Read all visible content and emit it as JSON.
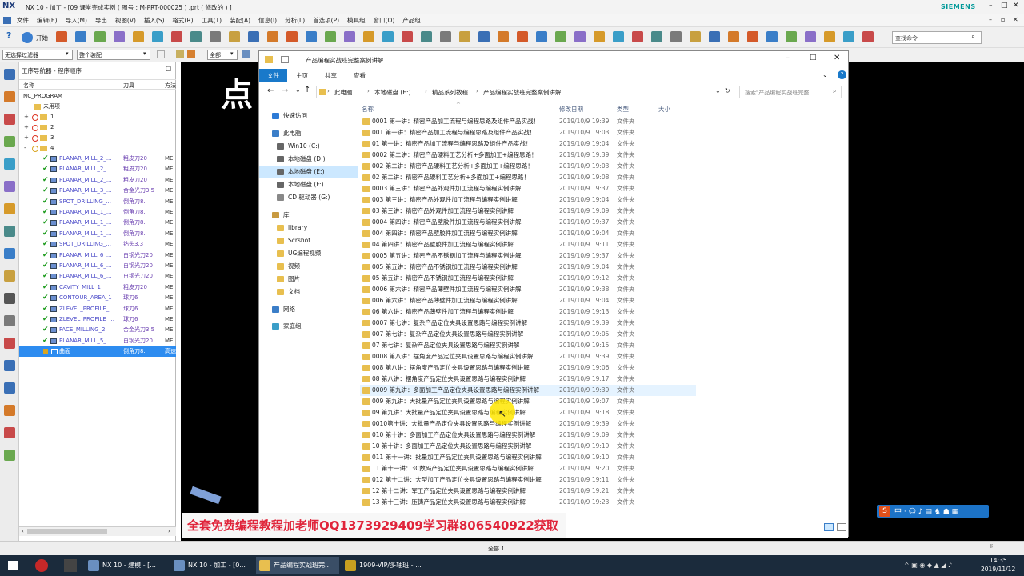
{
  "nx": {
    "logo": "NX",
    "title": "NX 10 - 加工 - [09 课堂完成实例 ( 图号 : M-PRT-000025 ) .prt ( 修改的 ) ]",
    "brand": "SIEMENS",
    "menu": [
      "文件",
      "编辑(E)",
      "导入(M)",
      "导出",
      "视图(V)",
      "插入(S)",
      "格式(R)",
      "工具(T)",
      "装配(A)",
      "信息(I)",
      "分析(L)",
      "首选项(P)",
      "模具组",
      "窗口(O)",
      "产品组"
    ],
    "start_label": "开始",
    "search_placeholder": "查找命令",
    "filter_value": "无选择过滤器",
    "assembly_value": "整个装配",
    "select_value": "全部",
    "status_text": "全部 1"
  },
  "navigator": {
    "title": "工序导航器 - 程序顺序",
    "col_name": "名称",
    "col_tool": "刀具",
    "col_method": "方法",
    "root": "NC_PROGRAM",
    "unused": "未用项",
    "groups": [
      "1",
      "2",
      "3",
      "4"
    ],
    "ops": [
      {
        "name": "PLANAR_MILL_2_...",
        "tool": "粗皮刀20",
        "mc": "ME"
      },
      {
        "name": "PLANAR_MILL_2_...",
        "tool": "粗皮刀20",
        "mc": "ME"
      },
      {
        "name": "PLANAR_MILL_2_...",
        "tool": "粗皮刀20",
        "mc": "ME"
      },
      {
        "name": "PLANAR_MILL_3_...",
        "tool": "合金光刀3.5",
        "mc": "ME"
      },
      {
        "name": "SPOT_DRILLING_...",
        "tool": "倒角刀8.",
        "mc": "ME"
      },
      {
        "name": "PLANAR_MILL_1_...",
        "tool": "倒角刀8.",
        "mc": "ME"
      },
      {
        "name": "PLANAR_MILL_1_...",
        "tool": "倒角刀8.",
        "mc": "ME"
      },
      {
        "name": "PLANAR_MILL_1_...",
        "tool": "倒角刀8.",
        "mc": "ME"
      },
      {
        "name": "SPOT_DRILLING_...",
        "tool": "钻头3.3",
        "mc": "ME"
      },
      {
        "name": "PLANAR_MILL_6_...",
        "tool": "白钢光刀20",
        "mc": "ME"
      },
      {
        "name": "PLANAR_MILL_6_...",
        "tool": "白钢光刀20",
        "mc": "ME"
      },
      {
        "name": "PLANAR_MILL_6_...",
        "tool": "白钢光刀20",
        "mc": "ME"
      },
      {
        "name": "CAVITY_MILL_1",
        "tool": "粗皮刀20",
        "mc": "ME"
      },
      {
        "name": "CONTOUR_AREA_1",
        "tool": "球刀6",
        "mc": "ME"
      },
      {
        "name": "ZLEVEL_PROFILE_...",
        "tool": "球刀6",
        "mc": "ME"
      },
      {
        "name": "ZLEVEL_PROFILE_...",
        "tool": "球刀6",
        "mc": "ME"
      },
      {
        "name": "FACE_MILLING_2",
        "tool": "合金光刀3.5",
        "mc": "ME"
      },
      {
        "name": "PLANAR_MILL_5_...",
        "tool": "白钢光刀20",
        "mc": "ME"
      }
    ],
    "selected": {
      "name": "曲面",
      "tool": "倒角刀8.",
      "mc": "高速"
    }
  },
  "viewport": {
    "overlay_char": "点"
  },
  "explorer": {
    "title": "产品编程实战班完整案例讲解",
    "tabs": [
      "文件",
      "主页",
      "共享",
      "查看"
    ],
    "breadcrumb": [
      "此电脑",
      "本地磁盘 (E:)",
      "精品系列教程",
      "产品编程实战班完整案例讲解"
    ],
    "search_placeholder": "搜索\"产品编程实战班完整...",
    "col_name": "名称",
    "col_date": "修改日期",
    "col_type": "类型",
    "col_size": "大小",
    "sidebar": [
      {
        "label": "快速访问",
        "kind": "star"
      },
      {
        "label": "此电脑",
        "kind": "pc"
      },
      {
        "label": "Win10 (C:)",
        "kind": "drive"
      },
      {
        "label": "本地磁盘 (D:)",
        "kind": "drive"
      },
      {
        "label": "本地磁盘 (E:)",
        "kind": "drive"
      },
      {
        "label": "本地磁盘 (F:)",
        "kind": "drive"
      },
      {
        "label": "CD 驱动器 (G:)",
        "kind": "cd"
      },
      {
        "label": "库",
        "kind": "lib"
      },
      {
        "label": "library",
        "kind": "folder"
      },
      {
        "label": "Scrshot",
        "kind": "folder"
      },
      {
        "label": "UG编程视频",
        "kind": "folder"
      },
      {
        "label": "视频",
        "kind": "folder"
      },
      {
        "label": "图片",
        "kind": "folder"
      },
      {
        "label": "文档",
        "kind": "folder"
      },
      {
        "label": "网络",
        "kind": "net"
      },
      {
        "label": "家庭组",
        "kind": "home"
      }
    ],
    "files": [
      {
        "name": "0001 第一讲：精密产品加工流程与编程思路及组件产品实战！",
        "date": "2019/10/9 19:39",
        "type": "文件夹"
      },
      {
        "name": "001 第一讲：精密产品加工流程与编程思路及组件产品实战！",
        "date": "2019/10/9 19:03",
        "type": "文件夹"
      },
      {
        "name": "01 第一讲：精密产品加工流程与编程思路及组件产品实战！",
        "date": "2019/10/9 19:04",
        "type": "文件夹"
      },
      {
        "name": "0002 第二讲：精密产品硬料工艺分析+多面加工+编程思路！",
        "date": "2019/10/9 19:39",
        "type": "文件夹"
      },
      {
        "name": "002 第二讲：精密产品硬料工艺分析+多面加工+编程思路！",
        "date": "2019/10/9 19:03",
        "type": "文件夹"
      },
      {
        "name": "02 第二讲：精密产品硬料工艺分析+多面加工+编程思路！",
        "date": "2019/10/9 19:08",
        "type": "文件夹"
      },
      {
        "name": "0003 第三讲：精密产品外观件加工流程与编程实例讲解",
        "date": "2019/10/9 19:37",
        "type": "文件夹"
      },
      {
        "name": "003 第三讲：精密产品外观件加工流程与编程实例讲解",
        "date": "2019/10/9 19:04",
        "type": "文件夹"
      },
      {
        "name": "03 第三讲：精密产品外观件加工流程与编程实例讲解",
        "date": "2019/10/9 19:09",
        "type": "文件夹"
      },
      {
        "name": "0004 第四讲：精密产品壁胶件加工流程与编程实例讲解",
        "date": "2019/10/9 19:37",
        "type": "文件夹"
      },
      {
        "name": "004 第四讲：精密产品壁胶件加工流程与编程实例讲解",
        "date": "2019/10/9 19:04",
        "type": "文件夹"
      },
      {
        "name": "04 第四讲：精密产品壁胶件加工流程与编程实例讲解",
        "date": "2019/10/9 19:11",
        "type": "文件夹"
      },
      {
        "name": "0005 第五讲：精密产品不锈钢加工流程与编程实例讲解",
        "date": "2019/10/9 19:37",
        "type": "文件夹"
      },
      {
        "name": "005 第五讲：精密产品不锈钢加工流程与编程实例讲解",
        "date": "2019/10/9 19:04",
        "type": "文件夹"
      },
      {
        "name": "05 第五讲：精密产品不锈钢加工流程与编程实例讲解",
        "date": "2019/10/9 19:12",
        "type": "文件夹"
      },
      {
        "name": "0006 第六讲：精密产品薄壁件加工流程与编程实例讲解",
        "date": "2019/10/9 19:38",
        "type": "文件夹"
      },
      {
        "name": "006 第六讲：精密产品薄壁件加工流程与编程实例讲解",
        "date": "2019/10/9 19:04",
        "type": "文件夹"
      },
      {
        "name": "06 第六讲：精密产品薄壁件加工流程与编程实例讲解",
        "date": "2019/10/9 19:13",
        "type": "文件夹"
      },
      {
        "name": "0007 第七讲：复杂产品定位夹具设置思路与编程实例讲解",
        "date": "2019/10/9 19:39",
        "type": "文件夹"
      },
      {
        "name": "007 第七讲：复杂产品定位夹具设置思路与编程实例讲解",
        "date": "2019/10/9 19:05",
        "type": "文件夹"
      },
      {
        "name": "07 第七讲：复杂产品定位夹具设置思路与编程实例讲解",
        "date": "2019/10/9 19:15",
        "type": "文件夹"
      },
      {
        "name": "0008 第八讲：摆角度产品定位夹具设置思路与编程实例讲解",
        "date": "2019/10/9 19:39",
        "type": "文件夹"
      },
      {
        "name": "008 第八讲：摆角度产品定位夹具设置思路与编程实例讲解",
        "date": "2019/10/9 19:06",
        "type": "文件夹"
      },
      {
        "name": "08 第八讲：摆角度产品定位夹具设置思路与编程实例讲解",
        "date": "2019/10/9 19:17",
        "type": "文件夹"
      },
      {
        "name": "0009 第九讲：多面加工产品定位夹具设置思路与编程实例讲解",
        "date": "2019/10/9 19:39",
        "type": "文件夹"
      },
      {
        "name": "009 第九讲：大批量产品定位夹具设置思路与编程实例讲解",
        "date": "2019/10/9 19:07",
        "type": "文件夹"
      },
      {
        "name": "09 第九讲：大批量产品定位夹具设置思路与编程实例讲解",
        "date": "2019/10/9 19:18",
        "type": "文件夹"
      },
      {
        "name": "0010第十讲：大批量产品定位夹具设置思路与编程实例讲解",
        "date": "2019/10/9 19:39",
        "type": "文件夹"
      },
      {
        "name": "010 第十讲：多面加工产品定位夹具设置思路与编程实例讲解",
        "date": "2019/10/9 19:09",
        "type": "文件夹"
      },
      {
        "name": "10 第十讲：多面加工产品定位夹具设置思路与编程实例讲解",
        "date": "2019/10/9 19:19",
        "type": "文件夹"
      },
      {
        "name": "011 第十一讲：批量加工产品定位夹具设置思路与编程实例讲解",
        "date": "2019/10/9 19:10",
        "type": "文件夹"
      },
      {
        "name": "11 第十一讲：3C数码产品定位夹具设置思路与编程实例讲解",
        "date": "2019/10/9 19:20",
        "type": "文件夹"
      },
      {
        "name": "012 第十二讲：大型加工产品定位夹具设置思路与编程实例讲解",
        "date": "2019/10/9 19:11",
        "type": "文件夹"
      },
      {
        "name": "12 第十二讲：军工产品定位夹具设置思路与编程实例讲解",
        "date": "2019/10/9 19:21",
        "type": "文件夹"
      },
      {
        "name": "13 第十三讲：压铸产品定位夹具设置思路与编程实例讲解",
        "date": "2019/10/9 19:23",
        "type": "文件夹"
      }
    ],
    "hovered_index": 24
  },
  "banner_text": "全套免费编程教程加老师QQ1373929409学习群806540922获取",
  "taskbar": {
    "buttons": [
      "NX 10 - 建模 - [...",
      "NX 10 - 加工 - [0...",
      "产品编程实战班完...",
      "1909-VIP/多轴班 - ..."
    ],
    "time": "14:35",
    "date": "2019/11/12"
  },
  "colors": {
    "accent": "#1979ca",
    "highlight": "#cce8ff",
    "hover": "#e5f3ff",
    "banner_red": "#e0243a"
  }
}
